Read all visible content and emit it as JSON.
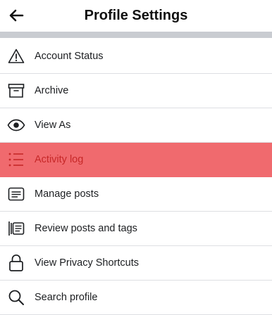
{
  "header": {
    "title": "Profile Settings",
    "back_icon": "arrow-left-icon"
  },
  "colors": {
    "highlight_background": "#f06a6e",
    "highlight_text": "#c62828",
    "separator": "#c9ccd1"
  },
  "menu": {
    "items": [
      {
        "label": "Account Status",
        "icon": "warning-triangle-icon",
        "highlighted": false
      },
      {
        "label": "Archive",
        "icon": "archive-box-icon",
        "highlighted": false
      },
      {
        "label": "View As",
        "icon": "eye-icon",
        "highlighted": false
      },
      {
        "label": "Activity log",
        "icon": "list-icon",
        "highlighted": true
      },
      {
        "label": "Manage posts",
        "icon": "posts-icon",
        "highlighted": false
      },
      {
        "label": "Review posts and tags",
        "icon": "review-tags-icon",
        "highlighted": false
      },
      {
        "label": "View Privacy Shortcuts",
        "icon": "lock-icon",
        "highlighted": false
      },
      {
        "label": "Search profile",
        "icon": "search-icon",
        "highlighted": false
      }
    ]
  }
}
